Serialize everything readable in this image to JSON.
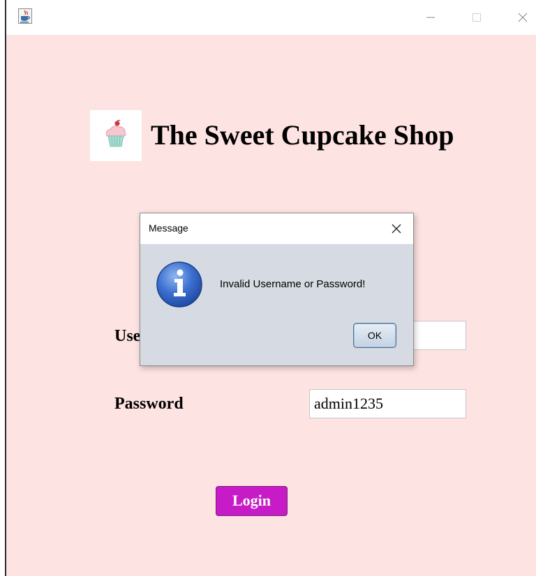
{
  "window": {
    "title_icon": "java-coffee-icon",
    "controls": [
      "minimize-icon",
      "maximize-icon",
      "close-icon"
    ]
  },
  "header": {
    "logo_icon": "cupcake-icon",
    "title": "The Sweet Cupcake Shop"
  },
  "form": {
    "username_label": "Username",
    "username_value": "",
    "password_label": "Password",
    "password_value": "admin1235",
    "login_label": "Login"
  },
  "dialog": {
    "title": "Message",
    "icon": "info-icon",
    "message": "Invalid Username or Password!",
    "ok_label": "OK"
  },
  "colors": {
    "background": "#fde3e1",
    "login_button": "#c61bc6",
    "dialog_body": "#d6dbe3"
  }
}
